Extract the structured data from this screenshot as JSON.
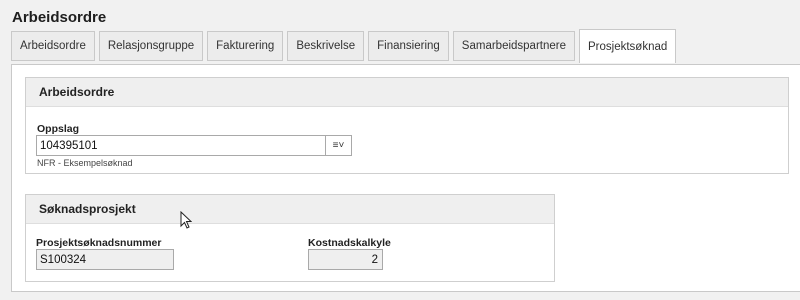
{
  "page": {
    "title": "Arbeidsordre"
  },
  "tabs": [
    {
      "label": "Arbeidsordre"
    },
    {
      "label": "Relasjonsgruppe"
    },
    {
      "label": "Fakturering"
    },
    {
      "label": "Beskrivelse"
    },
    {
      "label": "Finansiering"
    },
    {
      "label": "Samarbeidspartnere"
    },
    {
      "label": "Prosjektsøknad",
      "active": true
    }
  ],
  "arbeidsordre_group": {
    "title": "Arbeidsordre",
    "oppslag": {
      "label": "Oppslag",
      "value": "104395101",
      "hint": "NFR - Eksempelsøknad",
      "button_glyph": "≡˅"
    }
  },
  "soknadsprosjekt_group": {
    "title": "Søknadsprosjekt",
    "prosjektsoknadsnummer": {
      "label": "Prosjektsøknadsnummer",
      "value": "S100324"
    },
    "kostnadskalkyle": {
      "label": "Kostnadskalkyle",
      "value": "2"
    }
  },
  "icons": {
    "lookup": "list-dropdown-icon",
    "cursor": "mouse-pointer-icon"
  }
}
